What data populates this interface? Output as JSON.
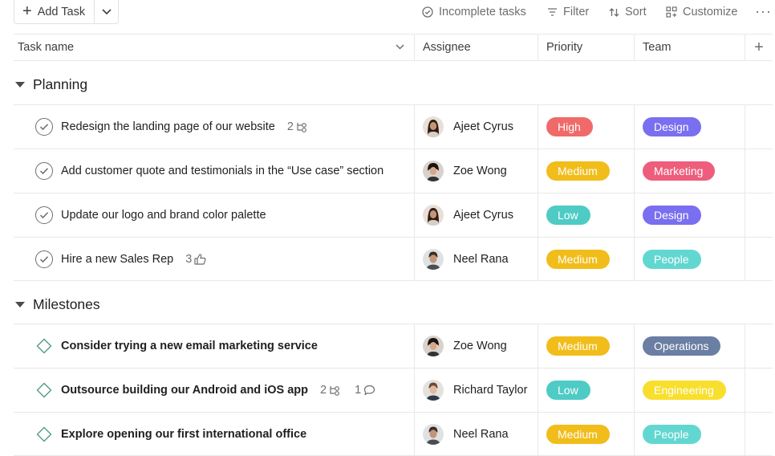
{
  "toolbar": {
    "add_task_label": "Add Task",
    "incomplete_label": "Incomplete tasks",
    "filter_label": "Filter",
    "sort_label": "Sort",
    "customize_label": "Customize",
    "more_label": "···"
  },
  "columns": {
    "task_name": "Task name",
    "assignee": "Assignee",
    "priority": "Priority",
    "team": "Team",
    "add": "+"
  },
  "sections": [
    {
      "title": "Planning",
      "rows": [
        {
          "task": "Redesign the landing page of our website",
          "subtasks": "2",
          "assignee": "Ajeet Cyrus",
          "priority": "High",
          "team": "Design"
        },
        {
          "task": "Add customer quote and testimonials in the “Use case” section",
          "assignee": "Zoe Wong",
          "priority": "Medium",
          "team": "Marketing"
        },
        {
          "task": "Update our logo and brand color palette",
          "assignee": "Ajeet Cyrus",
          "priority": "Low",
          "team": "Design"
        },
        {
          "task": "Hire a new Sales Rep",
          "likes": "3",
          "assignee": "Neel Rana",
          "priority": "Medium",
          "team": "People"
        }
      ]
    },
    {
      "title": "Milestones",
      "rows": [
        {
          "task": "Consider trying a new email marketing service",
          "assignee": "Zoe Wong",
          "priority": "Medium",
          "team": "Operations"
        },
        {
          "task": "Outsource building our Android and iOS app",
          "subtasks": "2",
          "comments": "1",
          "assignee": "Richard Taylor",
          "priority": "Low",
          "team": "Engineering"
        },
        {
          "task": "Explore opening our first international office",
          "assignee": "Neel Rana",
          "priority": "Medium",
          "team": "People"
        }
      ]
    }
  ],
  "colors": {
    "high": "#f06a6a",
    "medium": "#f1bd1b",
    "low": "#4ecbc4",
    "design": "#7a6ff0",
    "marketing": "#ee5e7c",
    "people": "#62d7d1",
    "operations": "#6b7ea3",
    "engineering": "#f8df2d",
    "milestone_green": "#58a182"
  }
}
